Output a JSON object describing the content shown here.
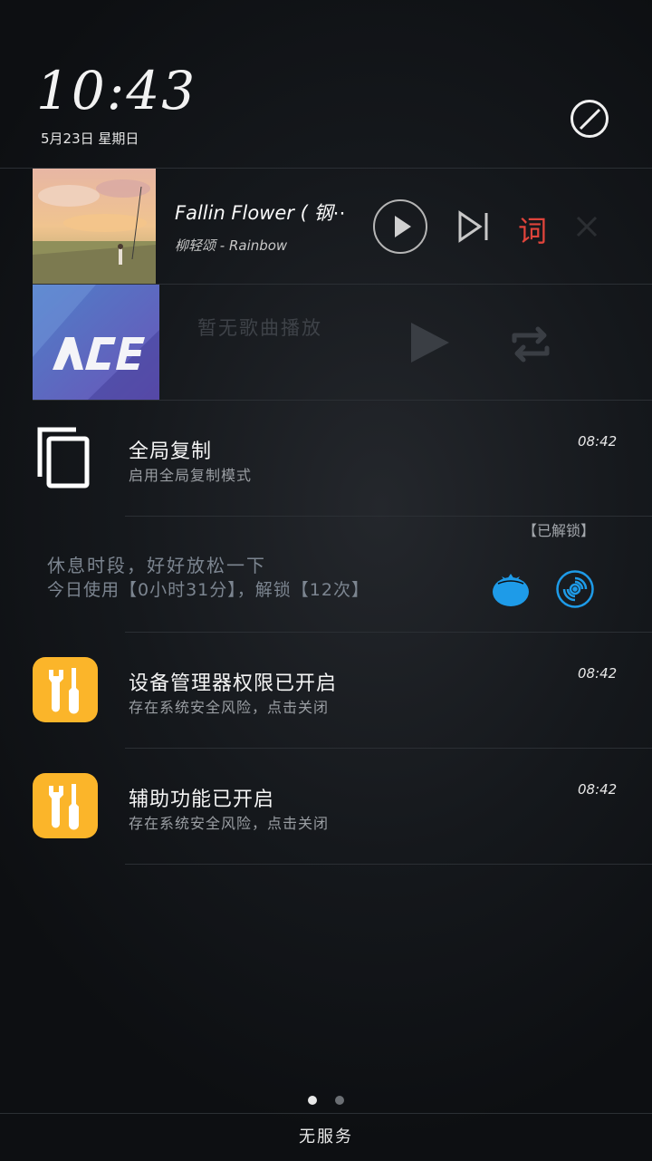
{
  "status": {
    "time": "10:43",
    "date": "5月23日 星期日",
    "dnd_icon": "do-not-disturb-icon"
  },
  "music_player_1": {
    "title": "Fallin Flower ( 钢⋯",
    "artist": "柳轻颂 - Rainbow",
    "lyric_label": "词",
    "accent_color": "#e0443b"
  },
  "music_player_2": {
    "status_text": "暂无歌曲播放",
    "album_label": "ACE"
  },
  "notifications": [
    {
      "title": "全局复制",
      "subtitle": "启用全局复制模式",
      "time": "08:42",
      "icon": "copy-icon"
    },
    {
      "title": "设备管理器权限已开启",
      "subtitle": "存在系统安全风险，点击关闭",
      "time": "08:42",
      "icon": "tools-icon"
    },
    {
      "title": "辅助功能已开启",
      "subtitle": "存在系统安全风险，点击关闭",
      "time": "08:42",
      "icon": "tools-icon"
    }
  ],
  "rest_widget": {
    "status": "【已解锁】",
    "line1": "休息时段，好好放松一下",
    "line2": "今日使用【0小时31分】，解锁【12次】",
    "tomato_color": "#1e9be8",
    "disc_color": "#1e9be8"
  },
  "pager": {
    "count": 2,
    "active": 1
  },
  "footer": {
    "carrier": "无服务"
  }
}
